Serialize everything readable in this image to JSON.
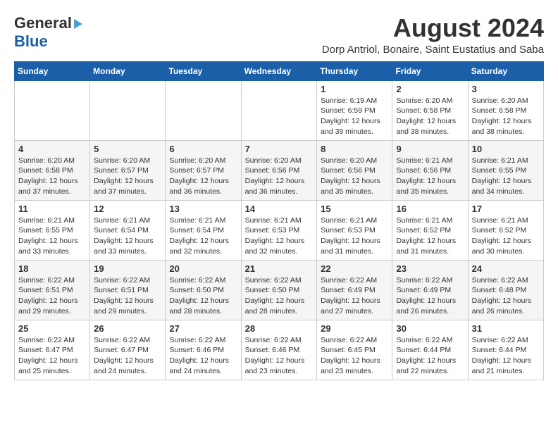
{
  "logo": {
    "line1": "General",
    "line2": "Blue"
  },
  "title": "August 2024",
  "location": "Dorp Antriol, Bonaire, Saint Eustatius and Saba",
  "weekdays": [
    "Sunday",
    "Monday",
    "Tuesday",
    "Wednesday",
    "Thursday",
    "Friday",
    "Saturday"
  ],
  "weeks": [
    [
      {
        "day": "",
        "info": ""
      },
      {
        "day": "",
        "info": ""
      },
      {
        "day": "",
        "info": ""
      },
      {
        "day": "",
        "info": ""
      },
      {
        "day": "1",
        "info": "Sunrise: 6:19 AM\nSunset: 6:59 PM\nDaylight: 12 hours\nand 39 minutes."
      },
      {
        "day": "2",
        "info": "Sunrise: 6:20 AM\nSunset: 6:58 PM\nDaylight: 12 hours\nand 38 minutes."
      },
      {
        "day": "3",
        "info": "Sunrise: 6:20 AM\nSunset: 6:58 PM\nDaylight: 12 hours\nand 38 minutes."
      }
    ],
    [
      {
        "day": "4",
        "info": "Sunrise: 6:20 AM\nSunset: 6:58 PM\nDaylight: 12 hours\nand 37 minutes."
      },
      {
        "day": "5",
        "info": "Sunrise: 6:20 AM\nSunset: 6:57 PM\nDaylight: 12 hours\nand 37 minutes."
      },
      {
        "day": "6",
        "info": "Sunrise: 6:20 AM\nSunset: 6:57 PM\nDaylight: 12 hours\nand 36 minutes."
      },
      {
        "day": "7",
        "info": "Sunrise: 6:20 AM\nSunset: 6:56 PM\nDaylight: 12 hours\nand 36 minutes."
      },
      {
        "day": "8",
        "info": "Sunrise: 6:20 AM\nSunset: 6:56 PM\nDaylight: 12 hours\nand 35 minutes."
      },
      {
        "day": "9",
        "info": "Sunrise: 6:21 AM\nSunset: 6:56 PM\nDaylight: 12 hours\nand 35 minutes."
      },
      {
        "day": "10",
        "info": "Sunrise: 6:21 AM\nSunset: 6:55 PM\nDaylight: 12 hours\nand 34 minutes."
      }
    ],
    [
      {
        "day": "11",
        "info": "Sunrise: 6:21 AM\nSunset: 6:55 PM\nDaylight: 12 hours\nand 33 minutes."
      },
      {
        "day": "12",
        "info": "Sunrise: 6:21 AM\nSunset: 6:54 PM\nDaylight: 12 hours\nand 33 minutes."
      },
      {
        "day": "13",
        "info": "Sunrise: 6:21 AM\nSunset: 6:54 PM\nDaylight: 12 hours\nand 32 minutes."
      },
      {
        "day": "14",
        "info": "Sunrise: 6:21 AM\nSunset: 6:53 PM\nDaylight: 12 hours\nand 32 minutes."
      },
      {
        "day": "15",
        "info": "Sunrise: 6:21 AM\nSunset: 6:53 PM\nDaylight: 12 hours\nand 31 minutes."
      },
      {
        "day": "16",
        "info": "Sunrise: 6:21 AM\nSunset: 6:52 PM\nDaylight: 12 hours\nand 31 minutes."
      },
      {
        "day": "17",
        "info": "Sunrise: 6:21 AM\nSunset: 6:52 PM\nDaylight: 12 hours\nand 30 minutes."
      }
    ],
    [
      {
        "day": "18",
        "info": "Sunrise: 6:22 AM\nSunset: 6:51 PM\nDaylight: 12 hours\nand 29 minutes."
      },
      {
        "day": "19",
        "info": "Sunrise: 6:22 AM\nSunset: 6:51 PM\nDaylight: 12 hours\nand 29 minutes."
      },
      {
        "day": "20",
        "info": "Sunrise: 6:22 AM\nSunset: 6:50 PM\nDaylight: 12 hours\nand 28 minutes."
      },
      {
        "day": "21",
        "info": "Sunrise: 6:22 AM\nSunset: 6:50 PM\nDaylight: 12 hours\nand 28 minutes."
      },
      {
        "day": "22",
        "info": "Sunrise: 6:22 AM\nSunset: 6:49 PM\nDaylight: 12 hours\nand 27 minutes."
      },
      {
        "day": "23",
        "info": "Sunrise: 6:22 AM\nSunset: 6:49 PM\nDaylight: 12 hours\nand 26 minutes."
      },
      {
        "day": "24",
        "info": "Sunrise: 6:22 AM\nSunset: 6:48 PM\nDaylight: 12 hours\nand 26 minutes."
      }
    ],
    [
      {
        "day": "25",
        "info": "Sunrise: 6:22 AM\nSunset: 6:47 PM\nDaylight: 12 hours\nand 25 minutes."
      },
      {
        "day": "26",
        "info": "Sunrise: 6:22 AM\nSunset: 6:47 PM\nDaylight: 12 hours\nand 24 minutes."
      },
      {
        "day": "27",
        "info": "Sunrise: 6:22 AM\nSunset: 6:46 PM\nDaylight: 12 hours\nand 24 minutes."
      },
      {
        "day": "28",
        "info": "Sunrise: 6:22 AM\nSunset: 6:46 PM\nDaylight: 12 hours\nand 23 minutes."
      },
      {
        "day": "29",
        "info": "Sunrise: 6:22 AM\nSunset: 6:45 PM\nDaylight: 12 hours\nand 23 minutes."
      },
      {
        "day": "30",
        "info": "Sunrise: 6:22 AM\nSunset: 6:44 PM\nDaylight: 12 hours\nand 22 minutes."
      },
      {
        "day": "31",
        "info": "Sunrise: 6:22 AM\nSunset: 6:44 PM\nDaylight: 12 hours\nand 21 minutes."
      }
    ]
  ]
}
